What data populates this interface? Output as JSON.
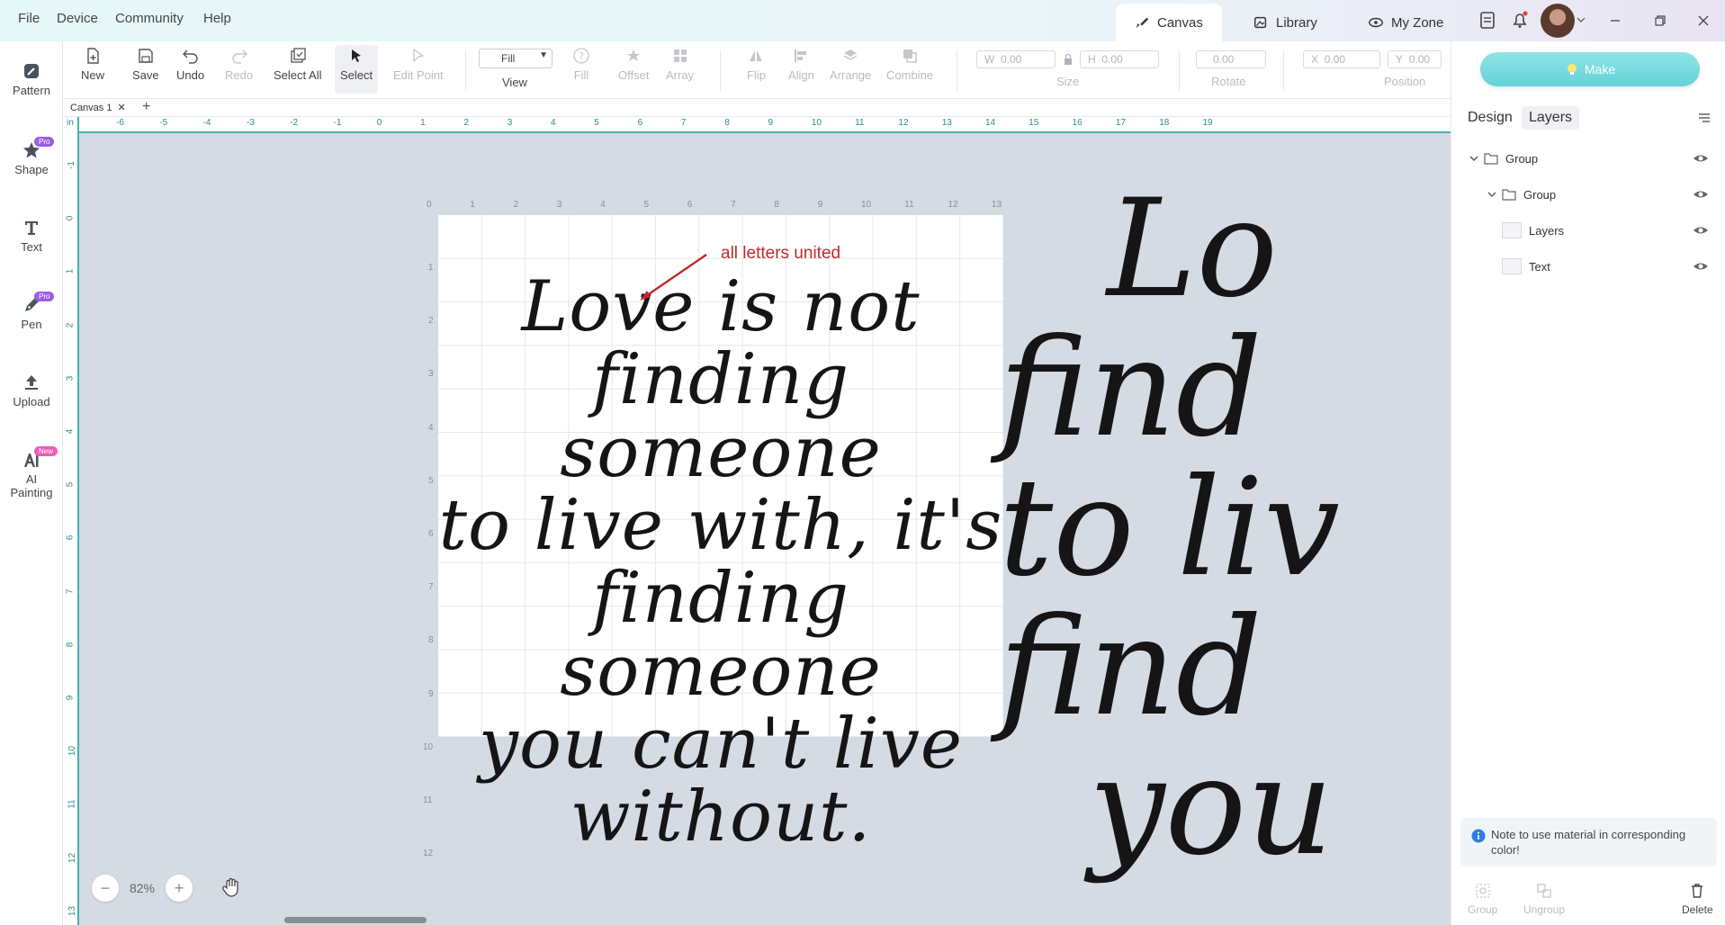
{
  "menu": [
    "File",
    "Device",
    "Community",
    "Help"
  ],
  "nav_tabs": [
    {
      "label": "Canvas",
      "icon": "canvas-icon",
      "active": true
    },
    {
      "label": "Library",
      "icon": "library-icon",
      "active": false
    },
    {
      "label": "My Zone",
      "icon": "my-zone-icon",
      "active": false
    }
  ],
  "left_sidebar": [
    {
      "label": "Pattern",
      "icon": "pattern-icon",
      "badge": ""
    },
    {
      "label": "Shape",
      "icon": "shape-icon",
      "badge": "Pro"
    },
    {
      "label": "Text",
      "icon": "text-icon",
      "badge": ""
    },
    {
      "label": "Pen",
      "icon": "pen-icon",
      "badge": "Pro"
    },
    {
      "label": "Upload",
      "icon": "upload-icon",
      "badge": ""
    },
    {
      "label": "AI",
      "label2": "Painting",
      "icon": "ai-painting-icon",
      "badge": "New"
    }
  ],
  "toolbar": {
    "new": "New",
    "save": "Save",
    "undo": "Undo",
    "redo": "Redo",
    "select_all": "Select All",
    "select": "Select",
    "edit_point": "Edit Point",
    "fill_mode": "Fill",
    "view": "View",
    "fill": "Fill",
    "offset": "Offset",
    "array": "Array",
    "flip": "Flip",
    "align": "Align",
    "arrange": "Arrange",
    "combine": "Combine",
    "size_w_label": "W",
    "size_w": "0.00",
    "size_h_label": "H",
    "size_h": "0.00",
    "size": "Size",
    "rotate_value": "0.00",
    "rotate": "Rotate",
    "pos_x_label": "X",
    "pos_x": "0.00",
    "pos_y_label": "Y",
    "pos_y": "0.00",
    "position": "Position"
  },
  "canvas_tab": "Canvas 1",
  "ruler_unit": "in",
  "ruler_top": [
    "-6",
    "-5",
    "-4",
    "-3",
    "-2",
    "-1",
    "0",
    "1",
    "2",
    "3",
    "4",
    "5",
    "6",
    "7",
    "8",
    "9",
    "10",
    "11",
    "12",
    "13",
    "14",
    "15",
    "16",
    "17",
    "18",
    "19"
  ],
  "ruler_left": [
    "-1",
    "0",
    "1",
    "2",
    "3",
    "4",
    "5",
    "6",
    "7",
    "8",
    "9",
    "10",
    "11",
    "12",
    "13"
  ],
  "artboard_top_ticks": [
    "0",
    "1",
    "2",
    "3",
    "4",
    "5",
    "6",
    "7",
    "8",
    "9",
    "10",
    "11",
    "12",
    "13"
  ],
  "artboard_left_ticks": [
    "1",
    "2",
    "3",
    "4",
    "5",
    "6",
    "7",
    "8",
    "9",
    "10",
    "11",
    "12"
  ],
  "design": {
    "quote_lines": [
      "Love is not",
      "finding someone",
      "to live with, it's",
      "finding someone",
      "you can't live",
      "without."
    ],
    "annotation": "all letters united",
    "preview_lines": [
      "Lo",
      "find",
      "to liv",
      "find",
      "you"
    ]
  },
  "zoom": {
    "value": "82%"
  },
  "right_panel": {
    "make": "Make",
    "tabs": [
      "Design",
      "Layers"
    ],
    "layers": [
      {
        "label": "Group",
        "level": 0,
        "type": "group"
      },
      {
        "label": "Group",
        "level": 1,
        "type": "group"
      },
      {
        "label": "Layers",
        "level": 2,
        "type": "item"
      },
      {
        "label": "Text",
        "level": 2,
        "type": "item"
      }
    ],
    "note": "Note to use material in corresponding color!",
    "bottom_actions": [
      "Group",
      "Ungroup",
      "Delete"
    ]
  },
  "colors": {
    "accent": "#46b0b7",
    "make_button": "#6fd6da",
    "annotation": "#c0292d",
    "canvas_bg": "#d5dbe3"
  }
}
